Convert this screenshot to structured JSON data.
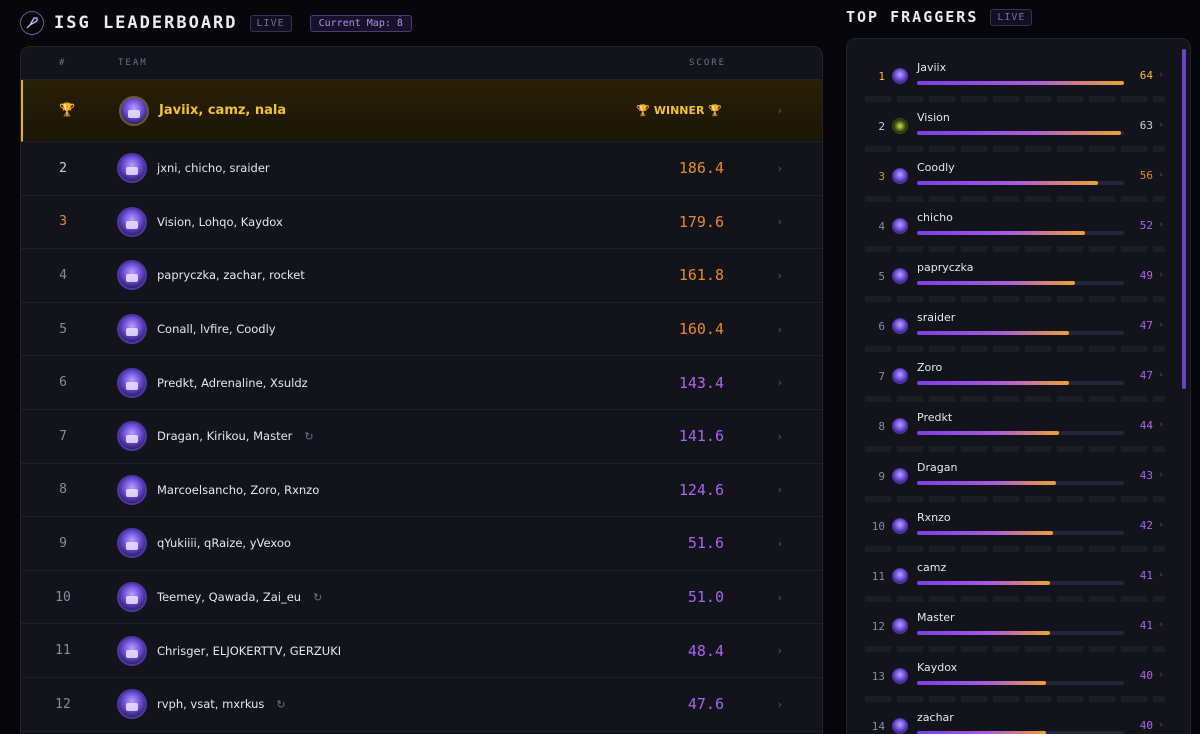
{
  "header": {
    "title": "ISG LEADERBOARD",
    "live": "LIVE",
    "current_map": "Current Map: 8"
  },
  "table": {
    "col_rank": "#",
    "col_team": "TEAM",
    "col_score": "SCORE",
    "winner_label": "WINNER",
    "rows": [
      {
        "rank": "",
        "team": "Javiix, camz, nala",
        "score": "",
        "winner": true
      },
      {
        "rank": "2",
        "team": "jxni, chicho, sraider",
        "score": "186.4"
      },
      {
        "rank": "3",
        "team": "Vision, Lohqo, Kaydox",
        "score": "179.6"
      },
      {
        "rank": "4",
        "team": "papryczka, zachar, rocket",
        "score": "161.8"
      },
      {
        "rank": "5",
        "team": "Conall, lvfire, Coodly",
        "score": "160.4"
      },
      {
        "rank": "6",
        "team": "Predkt, Adrenaline, Xsuldz",
        "score": "143.4"
      },
      {
        "rank": "7",
        "team": "Dragan, Kirikou, Master",
        "score": "141.6",
        "refresh": true
      },
      {
        "rank": "8",
        "team": "Marcoelsancho, Zoro, Rxnzo",
        "score": "124.6"
      },
      {
        "rank": "9",
        "team": "qYukiiii, qRaize, yVexoo",
        "score": "51.6"
      },
      {
        "rank": "10",
        "team": "Teemey, Qawada, Zai_eu",
        "score": "51.0",
        "refresh": true
      },
      {
        "rank": "11",
        "team": "Chrisger, ELJOKERTTV, GERZUKI",
        "score": "48.4"
      },
      {
        "rank": "12",
        "team": "rvph, vsat, mxrkus",
        "score": "47.6",
        "refresh": true
      }
    ]
  },
  "fraggers": {
    "title": "TOP FRAGGERS",
    "live": "LIVE",
    "max": 64,
    "list": [
      {
        "rank": "1",
        "name": "Javiix",
        "score": 64
      },
      {
        "rank": "2",
        "name": "Vision",
        "score": 63
      },
      {
        "rank": "3",
        "name": "Coodly",
        "score": 56
      },
      {
        "rank": "4",
        "name": "chicho",
        "score": 52
      },
      {
        "rank": "5",
        "name": "papryczka",
        "score": 49
      },
      {
        "rank": "6",
        "name": "sraider",
        "score": 47
      },
      {
        "rank": "7",
        "name": "Zoro",
        "score": 47
      },
      {
        "rank": "8",
        "name": "Predkt",
        "score": 44
      },
      {
        "rank": "9",
        "name": "Dragan",
        "score": 43
      },
      {
        "rank": "10",
        "name": "Rxnzo",
        "score": 42
      },
      {
        "rank": "11",
        "name": "camz",
        "score": 41
      },
      {
        "rank": "12",
        "name": "Master",
        "score": 41
      },
      {
        "rank": "13",
        "name": "Kaydox",
        "score": 40
      },
      {
        "rank": "14",
        "name": "zachar",
        "score": 40
      }
    ]
  },
  "colors": {
    "gold": "#f2c230",
    "orange": "#e68a2a",
    "purple": "#a964f0",
    "background": "#07070b"
  },
  "icons": {
    "logo": "rocket-logo-icon",
    "trophy": "trophy-icon",
    "chevron": "chevron-right-icon",
    "refresh": "refresh-icon"
  }
}
